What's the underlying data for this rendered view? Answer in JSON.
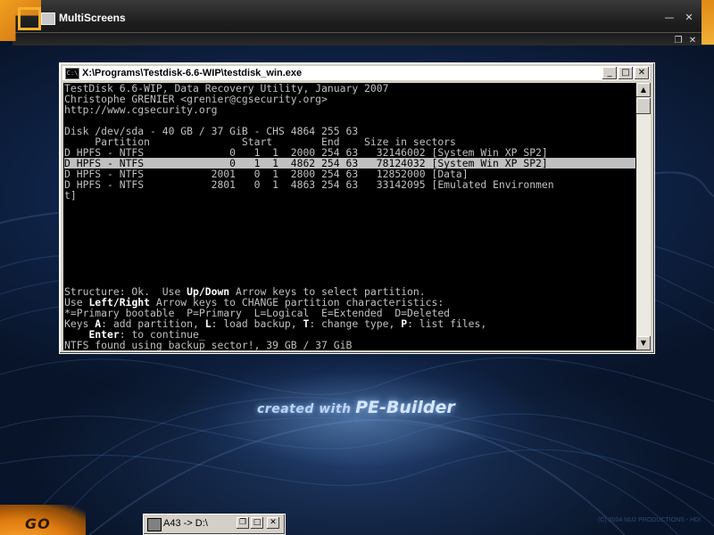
{
  "multiscreens": {
    "title": "MultiScreens",
    "min_icon": "—",
    "close_icon": "✕",
    "restore_icon": "❐",
    "accent_color": "#e8901a"
  },
  "console_window": {
    "title": "X:\\Programs\\Testdisk-6.6-WIP\\testdisk_win.exe",
    "icon_label": "C:\\",
    "buttons": {
      "minimize": "_",
      "maximize": "□",
      "close": "✕"
    },
    "lines": [
      "TestDisk 6.6-WIP, Data Recovery Utility, January 2007",
      "Christophe GRENIER <grenier@cgsecurity.org>",
      "http://www.cgsecurity.org",
      "",
      "Disk /dev/sda - 40 GB / 37 GiB - CHS 4864 255 63",
      "     Partition               Start        End    Size in sectors",
      "D HPFS - NTFS              0   1  1  2000 254 63   32146002 [System Win XP SP2]",
      "D HPFS - NTFS              0   1  1  4862 254 63   78124032 [System Win XP SP2]",
      "D HPFS - NTFS           2001   0  1  2800 254 63   12852000 [Data]",
      "D HPFS - NTFS           2801   0  1  4863 254 63   33142095 [Emulated Environmen",
      "t]"
    ],
    "selected_line_index": 7,
    "footer": {
      "structure_pre": "Structure: Ok.  Use ",
      "structure_keys": "Up/Down",
      "structure_post": " Arrow keys to select partition.",
      "use_pre": "Use ",
      "use_keys": "Left/Right",
      "use_post": " Arrow keys to CHANGE partition characteristics:",
      "types": "*=Primary bootable  P=Primary  L=Logical  E=Extended  D=Deleted",
      "keys_pre": "Keys ",
      "key_a": "A",
      "keys_a_text": ": add partition, ",
      "key_l": "L",
      "keys_l_text": ": load backup, ",
      "key_t": "T",
      "keys_t_text": ": change type, ",
      "key_p": "P",
      "keys_p_text": ": list files,",
      "enter_key": "Enter",
      "enter_text": ": to continue",
      "cursor": "_",
      "status": "NTFS found using backup sector!, 39 GB / 37 GiB"
    },
    "scrollbar": {
      "up": "▲",
      "down": "▼"
    }
  },
  "logo": {
    "small": "created with",
    "big": "PE-Builder"
  },
  "go_button": {
    "label": "GO"
  },
  "taskbar": {
    "window_label": "A43 -> D:\\",
    "restore": "❐",
    "maximize": "□",
    "close": "✕"
  },
  "copyright": "(C) 2004 NU2 PRODUCTIONS - HDI"
}
